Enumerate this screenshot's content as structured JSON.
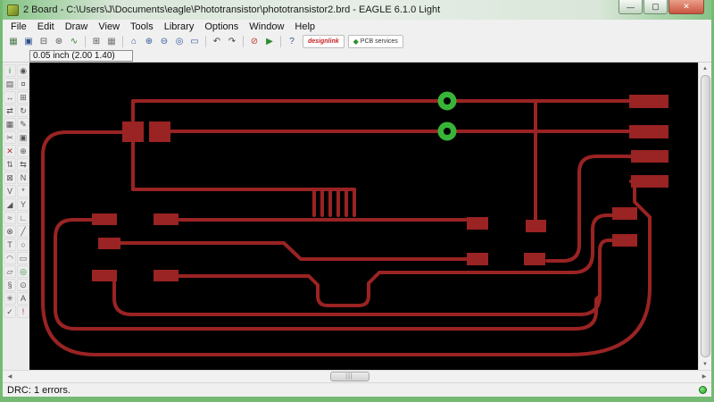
{
  "window": {
    "title": "2 Board - C:\\Users\\J\\Documents\\eagle\\Phototransistor\\phototransistor2.brd - EAGLE 6.1.0 Light",
    "controls": {
      "minimize": "—",
      "maximize": "▢",
      "close": "✕"
    }
  },
  "menu": {
    "items": [
      "File",
      "Edit",
      "Draw",
      "View",
      "Tools",
      "Library",
      "Options",
      "Window",
      "Help"
    ]
  },
  "toolbar": {
    "icons": [
      {
        "name": "control-panel-icon",
        "glyph": "▦",
        "color": "#4a7a4a"
      },
      {
        "name": "save-icon",
        "glyph": "▣",
        "color": "#2e4f8e"
      },
      {
        "name": "print-icon",
        "glyph": "⊟",
        "color": "#555555"
      },
      {
        "name": "cam-processor-icon",
        "glyph": "⊛",
        "color": "#555555"
      },
      {
        "name": "switch-to-schematic-icon",
        "glyph": "∿",
        "color": "#2e7d2e"
      },
      {
        "sep": true
      },
      {
        "name": "load-design-icon",
        "glyph": "⊞",
        "color": "#555555"
      },
      {
        "name": "grid-icon",
        "glyph": "▦",
        "color": "#777777"
      },
      {
        "sep": true
      },
      {
        "name": "zoom-fit-icon",
        "glyph": "⌂",
        "color": "#33589e"
      },
      {
        "name": "zoom-in-icon",
        "glyph": "⊕",
        "color": "#33589e"
      },
      {
        "name": "zoom-out-icon",
        "glyph": "⊖",
        "color": "#33589e"
      },
      {
        "name": "zoom-redraw-icon",
        "glyph": "◎",
        "color": "#33589e"
      },
      {
        "name": "zoom-select-icon",
        "glyph": "▭",
        "color": "#33589e"
      },
      {
        "sep": true
      },
      {
        "name": "undo-icon",
        "glyph": "↶",
        "color": "#444444"
      },
      {
        "name": "redo-icon",
        "glyph": "↷",
        "color": "#444444"
      },
      {
        "sep": true
      },
      {
        "name": "stop-icon",
        "glyph": "⊘",
        "color": "#c0392b"
      },
      {
        "name": "go-icon",
        "glyph": "▶",
        "color": "#2e8b2e"
      },
      {
        "sep": true
      },
      {
        "name": "help-icon",
        "glyph": "?",
        "color": "#2e4f8e"
      }
    ],
    "designlink_label": "designlink",
    "pcbservice_glyph": "◆",
    "pcbservice_label": "PCB services"
  },
  "coordbar": {
    "value": "0.05 inch (2.00 1.40)"
  },
  "palette": {
    "tools": [
      {
        "name": "info-tool",
        "glyph": "i",
        "color": "#1d7a1d"
      },
      {
        "name": "show-tool",
        "glyph": "◉",
        "color": "#555555"
      },
      {
        "name": "display-tool",
        "glyph": "▤",
        "color": "#555555"
      },
      {
        "name": "mark-tool",
        "glyph": "¤",
        "color": "#555555"
      },
      {
        "name": "move-tool",
        "glyph": "↔",
        "color": "#555555"
      },
      {
        "name": "copy-tool",
        "glyph": "⊞",
        "color": "#555555"
      },
      {
        "name": "mirror-tool",
        "glyph": "⇄",
        "color": "#555555"
      },
      {
        "name": "rotate-tool",
        "glyph": "↻",
        "color": "#555555"
      },
      {
        "name": "group-tool",
        "glyph": "▦",
        "color": "#555555"
      },
      {
        "name": "change-tool",
        "glyph": "✎",
        "color": "#555555"
      },
      {
        "name": "cut-tool",
        "glyph": "✂",
        "color": "#555555"
      },
      {
        "name": "paste-tool",
        "glyph": "▣",
        "color": "#555555"
      },
      {
        "name": "delete-tool",
        "glyph": "✕",
        "color": "#b03030"
      },
      {
        "name": "add-tool",
        "glyph": "⊕",
        "color": "#555555"
      },
      {
        "name": "pinswap-tool",
        "glyph": "⇅",
        "color": "#555555"
      },
      {
        "name": "replace-tool",
        "glyph": "⇆",
        "color": "#555555"
      },
      {
        "name": "lock-tool",
        "glyph": "⊠",
        "color": "#555555"
      },
      {
        "name": "name-tool",
        "glyph": "N",
        "color": "#555555"
      },
      {
        "name": "value-tool",
        "glyph": "V",
        "color": "#555555"
      },
      {
        "name": "smash-tool",
        "glyph": "*",
        "color": "#555555"
      },
      {
        "name": "miter-tool",
        "glyph": "◢",
        "color": "#555555"
      },
      {
        "name": "split-tool",
        "glyph": "Y",
        "color": "#555555"
      },
      {
        "name": "optimize-tool",
        "glyph": "≈",
        "color": "#555555"
      },
      {
        "name": "route-tool",
        "glyph": "∟",
        "color": "#555555"
      },
      {
        "name": "ripup-tool",
        "glyph": "⊗",
        "color": "#555555"
      },
      {
        "name": "wire-tool",
        "glyph": "╱",
        "color": "#555555"
      },
      {
        "name": "text-tool",
        "glyph": "T",
        "color": "#555555"
      },
      {
        "name": "circle-tool",
        "glyph": "○",
        "color": "#555555"
      },
      {
        "name": "arc-tool",
        "glyph": "◠",
        "color": "#555555"
      },
      {
        "name": "rect-tool",
        "glyph": "▭",
        "color": "#555555"
      },
      {
        "name": "polygon-tool",
        "glyph": "▱",
        "color": "#555555"
      },
      {
        "name": "via-tool",
        "glyph": "◎",
        "color": "#2e8b2e"
      },
      {
        "name": "signal-tool",
        "glyph": "§",
        "color": "#555555"
      },
      {
        "name": "hole-tool",
        "glyph": "⊙",
        "color": "#555555"
      },
      {
        "name": "ratsnest-tool",
        "glyph": "✳",
        "color": "#555555"
      },
      {
        "name": "auto-tool",
        "glyph": "A",
        "color": "#555555"
      },
      {
        "name": "drc-tool",
        "glyph": "✓",
        "color": "#555555"
      },
      {
        "name": "errors-tool",
        "glyph": "!",
        "color": "#b03030"
      }
    ]
  },
  "scrollbar": {
    "up": "▲",
    "down": "▼",
    "left": "◀",
    "right": "▶",
    "grip": "|||"
  },
  "statusbar": {
    "text": "DRC: 1 errors."
  },
  "colors": {
    "copper_trace": "#9a2323",
    "via_ring_green": "#38b438",
    "canvas_background": "#000000",
    "window_chrome_green": "#74ba74",
    "close_button_red": "#c95540"
  }
}
